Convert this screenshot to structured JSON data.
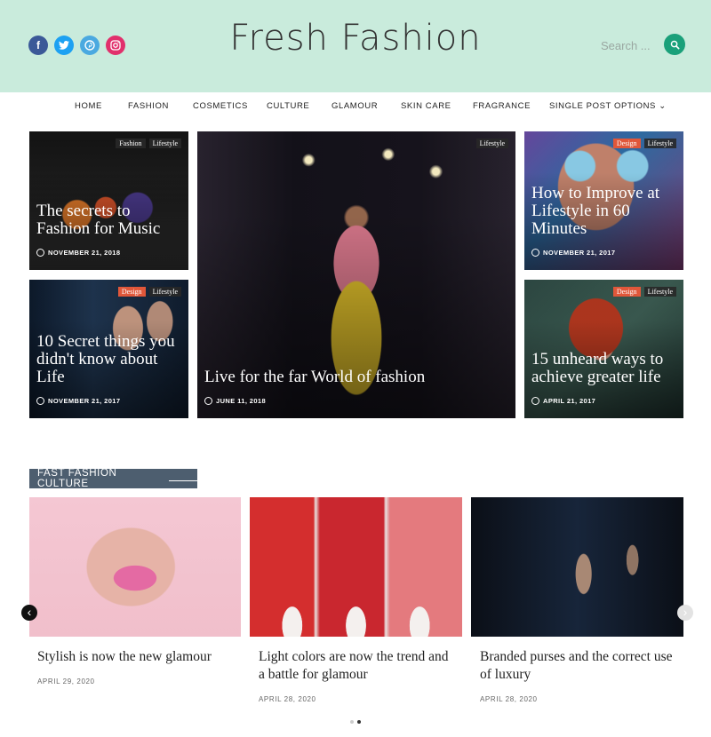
{
  "header": {
    "site_title": "Fresh Fashion",
    "search_placeholder": "Search ...",
    "social": [
      "f",
      "t",
      "p",
      "i"
    ],
    "colors": {
      "header_bg": "#c9ebdc",
      "search_button": "#1aa07a",
      "facebook": "#3b5998",
      "twitter": "#1da1f2",
      "pinterest": "#4aa9e0",
      "instagram": "#e1306c"
    }
  },
  "nav": {
    "items": [
      "HOME",
      "FASHION",
      "COSMETICS",
      "CULTURE",
      "GLAMOUR",
      "SKIN CARE",
      "FRAGRANCE",
      "SINGLE POST OPTIONS"
    ],
    "dropdown_glyph": "⌄"
  },
  "featured": [
    {
      "title": "The secrets to Fashion for Music",
      "date": "NOVEMBER 21, 2018",
      "cats": [
        "Fashion",
        "Lifestyle"
      ]
    },
    {
      "title": "Live for the far World of fashion",
      "date": "JUNE 11, 2018",
      "cats": [
        "Lifestyle"
      ]
    },
    {
      "title": "How to Improve at Lifestyle in 60 Minutes",
      "date": "NOVEMBER 21, 2017",
      "cats": [
        "Design",
        "Lifestyle"
      ]
    },
    {
      "title": "10 Secret things you didn't know about Life",
      "date": "NOVEMBER 21, 2017",
      "cats": [
        "Design",
        "Lifestyle"
      ]
    },
    {
      "title": "15 unheard ways to achieve greater life",
      "date": "APRIL 21, 2017",
      "cats": [
        "Design",
        "Lifestyle"
      ]
    }
  ],
  "section": {
    "title": "FAST FASHION CULTURE",
    "cards": [
      {
        "title": "Stylish is now the new glamour",
        "date": "APRIL 29, 2020"
      },
      {
        "title": "Light colors are now the trend and a battle for glamour",
        "date": "APRIL 28, 2020"
      },
      {
        "title": "Branded purses and the correct use of luxury",
        "date": "APRIL 28, 2020"
      }
    ],
    "prev_glyph": "‹",
    "next_glyph": "›"
  }
}
